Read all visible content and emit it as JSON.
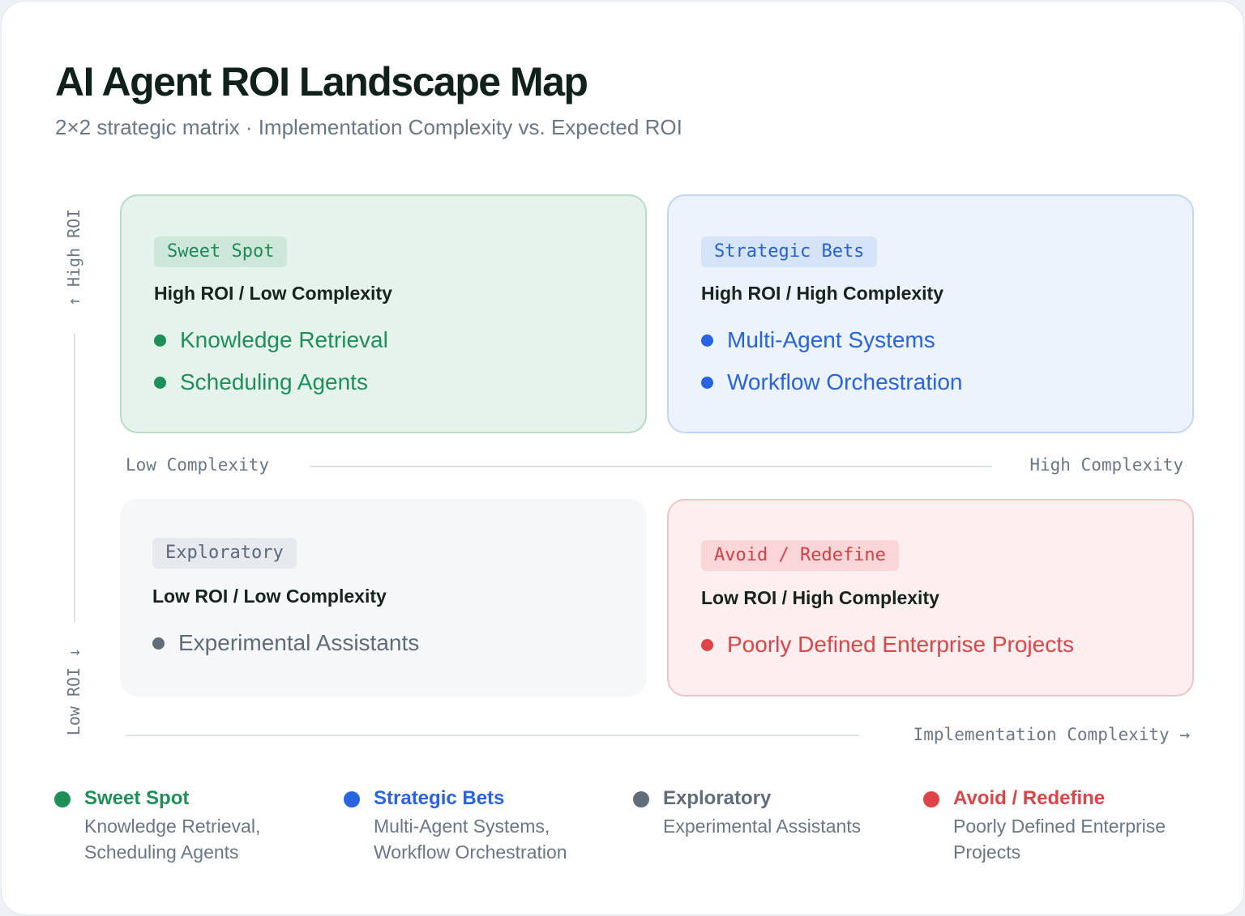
{
  "header": {
    "title": "AI Agent ROI Landscape Map",
    "subtitle": "2×2 strategic matrix · Implementation Complexity vs. Expected ROI"
  },
  "axes": {
    "y_high": "↑ High ROI",
    "y_low": "Low ROI ↓",
    "x_low": "Low Complexity",
    "x_high": "High Complexity",
    "x_title": "Implementation Complexity →"
  },
  "quadrants": [
    {
      "badge": "Sweet Spot",
      "subtitle": "High ROI / Low Complexity",
      "items": [
        "Knowledge Retrieval",
        "Scheduling Agents"
      ],
      "color": "#1f8f5a"
    },
    {
      "badge": "Strategic Bets",
      "subtitle": "High ROI / High Complexity",
      "items": [
        "Multi-Agent Systems",
        "Workflow Orchestration"
      ],
      "color": "#2863e0"
    },
    {
      "badge": "Exploratory",
      "subtitle": "Low ROI / Low Complexity",
      "items": [
        "Experimental Assistants"
      ],
      "color": "#616c7b"
    },
    {
      "badge": "Avoid / Redefine",
      "subtitle": "Low ROI / High Complexity",
      "items": [
        "Poorly Defined Enterprise Projects"
      ],
      "color": "#dd4448"
    }
  ],
  "legend": [
    {
      "name": "Sweet Spot",
      "line1": "Knowledge Retrieval,",
      "line2": "Scheduling Agents"
    },
    {
      "name": "Strategic Bets",
      "line1": "Multi-Agent Systems,",
      "line2": "Workflow Orchestration"
    },
    {
      "name": "Exploratory",
      "line1": "Experimental Assistants",
      "line2": ""
    },
    {
      "name": "Avoid / Redefine",
      "line1": "Poorly Defined Enterprise",
      "line2": "Projects"
    }
  ]
}
